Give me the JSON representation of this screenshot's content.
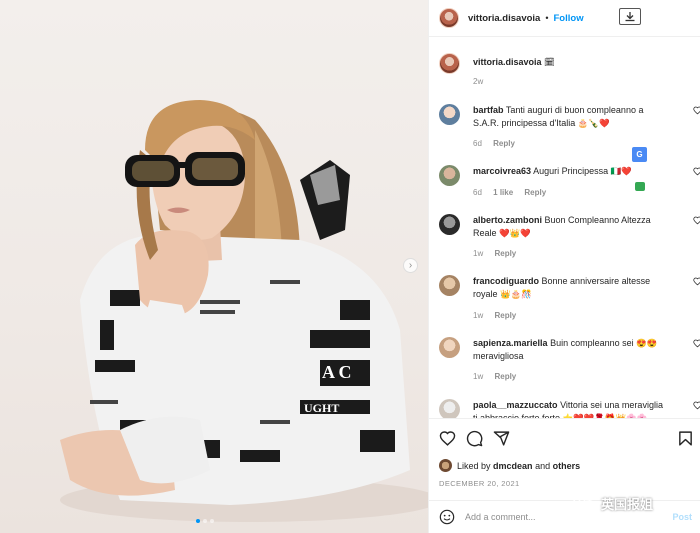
{
  "header": {
    "username": "vittoria.disavoia",
    "separator": "•",
    "follow_label": "Follow"
  },
  "caption": {
    "username": "vittoria.disavoia",
    "emoji": "🗓",
    "time": "2w"
  },
  "comments": [
    {
      "user": "bartfab",
      "text": "Tanti auguri di buon compleanno a S.A.R. principessa d'Italia",
      "emoji": "🎂🍾❤️",
      "time": "6d",
      "likes": "",
      "reply": "Reply"
    },
    {
      "user": "marcoivrea63",
      "text": "Auguri Principessa",
      "emoji": "🇮🇹❤️",
      "time": "6d",
      "likes": "1 like",
      "reply": "Reply"
    },
    {
      "user": "alberto.zamboni",
      "text": "Buon Compleanno Altezza Reale",
      "emoji": "❤️👑❤️",
      "time": "1w",
      "likes": "",
      "reply": "Reply"
    },
    {
      "user": "francodiguardo",
      "text": "Bonne anniversaire altesse royale",
      "emoji": "👑🎂🎊",
      "time": "1w",
      "likes": "",
      "reply": "Reply"
    },
    {
      "user": "sapienza.mariella",
      "text": "Buin compleanno sei",
      "emoji": "😍😍",
      "text2": "meravigliosa",
      "time": "1w",
      "likes": "",
      "reply": "Reply"
    },
    {
      "user": "paola__mazzuccato",
      "text": "Vittoria sei una meraviglia ti abbraccio forte forte",
      "emoji": "⭐️❤️❤️🌹🎁👑🌸🌸",
      "time": "",
      "likes": "",
      "reply": ""
    }
  ],
  "likes": {
    "prefix": "Liked by",
    "user": "dmcdean",
    "joiner": "and",
    "others": "others"
  },
  "date": "DECEMBER 20, 2021",
  "add_comment": {
    "placeholder": "Add a comment...",
    "post_label": "Post"
  },
  "watermark": "英国报姐",
  "icons": {
    "download": "download-icon",
    "heart": "heart-icon",
    "comment": "comment-icon",
    "share": "share-icon",
    "save": "bookmark-icon",
    "emoji": "smiley-icon",
    "next": "chevron-right-icon"
  },
  "colors": {
    "accent": "#0095f6",
    "heart": "#ed4956",
    "muted": "#8e8e8e",
    "post_disabled": "#b2dffc"
  }
}
